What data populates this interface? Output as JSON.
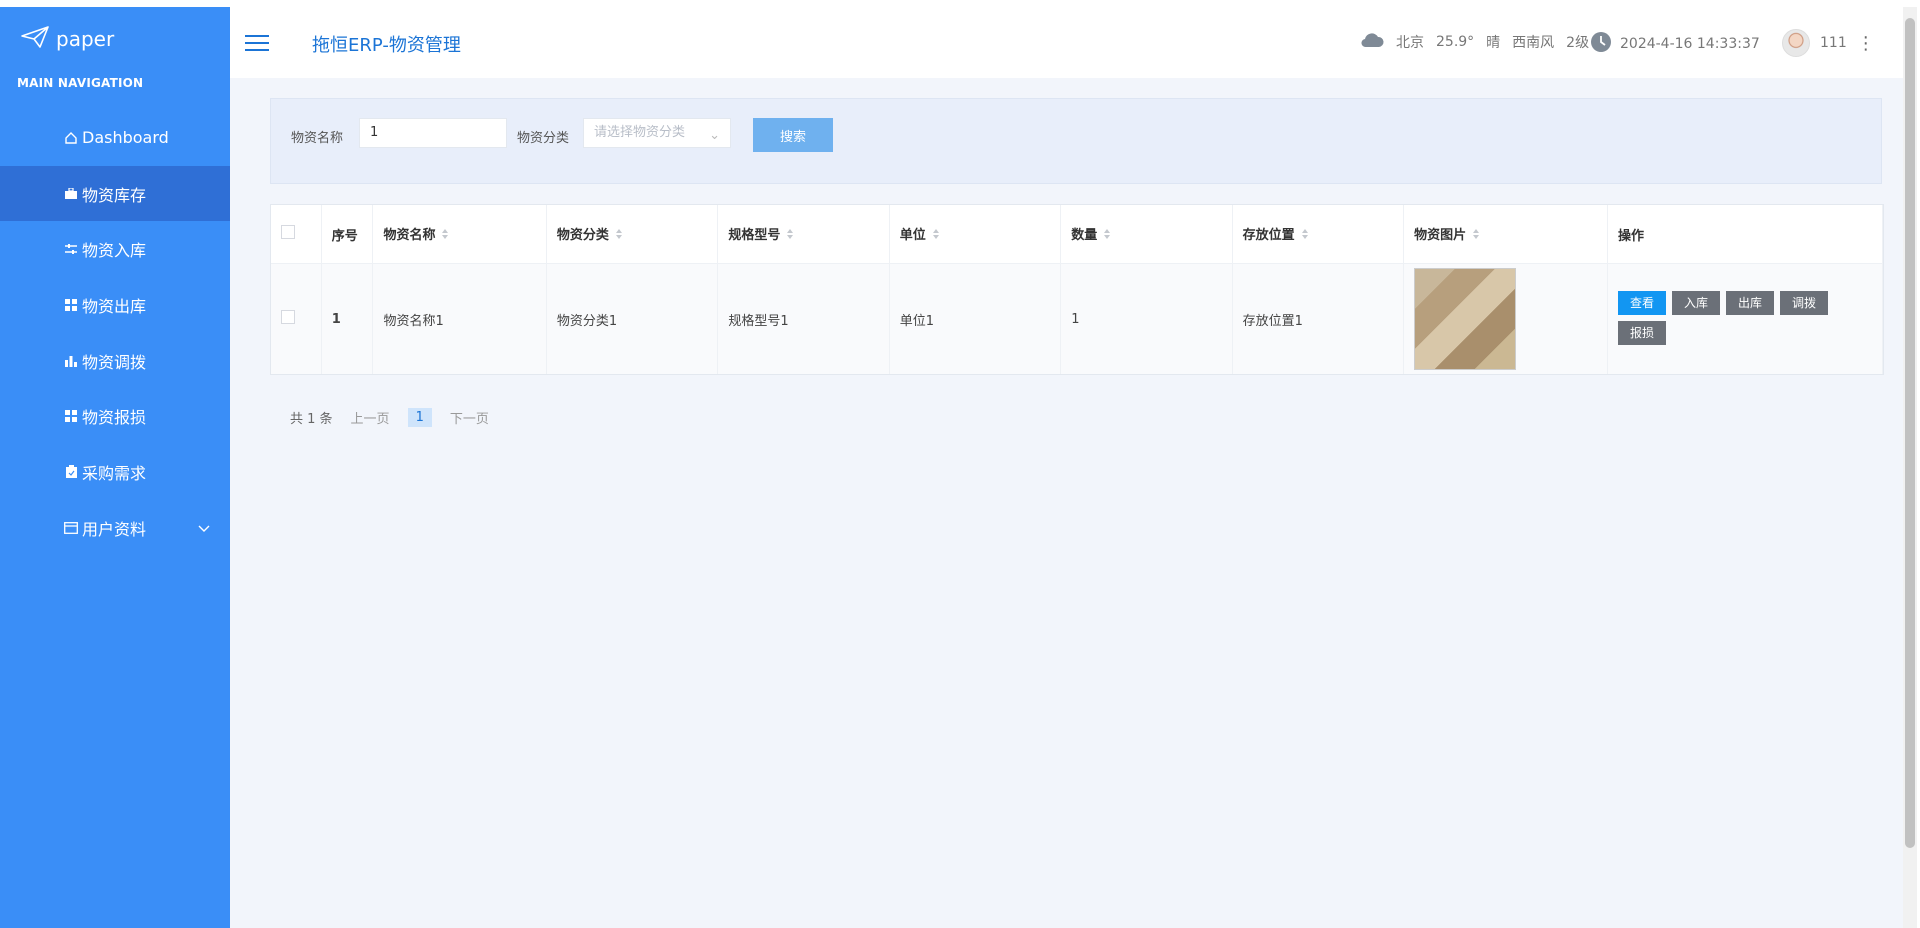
{
  "sidebar": {
    "logo_text": "paper",
    "nav_header": "MAIN NAVIGATION",
    "items": [
      {
        "label": "Dashboard",
        "icon": "home-icon"
      },
      {
        "label": "物资库存",
        "icon": "briefcase-icon"
      },
      {
        "label": "物资入库",
        "icon": "sliders-icon"
      },
      {
        "label": "物资出库",
        "icon": "grid-icon"
      },
      {
        "label": "物资调拨",
        "icon": "bar-chart-icon"
      },
      {
        "label": "物资报损",
        "icon": "grid-icon"
      },
      {
        "label": "采购需求",
        "icon": "clipboard-icon"
      },
      {
        "label": "用户资料",
        "icon": "card-icon"
      }
    ]
  },
  "topbar": {
    "title": "拖恒ERP-物资管理",
    "weather": {
      "city": "北京",
      "temp": "25.9°",
      "condition": "晴",
      "wind": "西南风",
      "level": "2级"
    },
    "datetime": "2024-4-16 14:33:37",
    "user": "111"
  },
  "search": {
    "name_label": "物资名称",
    "name_value": "1",
    "category_label": "物资分类",
    "category_placeholder": "请选择物资分类",
    "search_button": "搜索"
  },
  "table": {
    "headers": [
      "序号",
      "物资名称",
      "物资分类",
      "规格型号",
      "单位",
      "数量",
      "存放位置",
      "物资图片",
      "操作"
    ],
    "rows": [
      {
        "index": "1",
        "name": "物资名称1",
        "category": "物资分类1",
        "spec": "规格型号1",
        "unit": "单位1",
        "qty": "1",
        "location": "存放位置1"
      }
    ],
    "actions": [
      "查看",
      "入库",
      "出库",
      "调拨",
      "报损"
    ]
  },
  "pagination": {
    "total": "共 1 条",
    "prev": "上一页",
    "current": "1",
    "next": "下一页"
  },
  "colors": {
    "sidebar": "#3a8ef7",
    "sidebar_active": "#2f6fd6",
    "primary": "#1296f2",
    "title": "#1b74d6"
  }
}
